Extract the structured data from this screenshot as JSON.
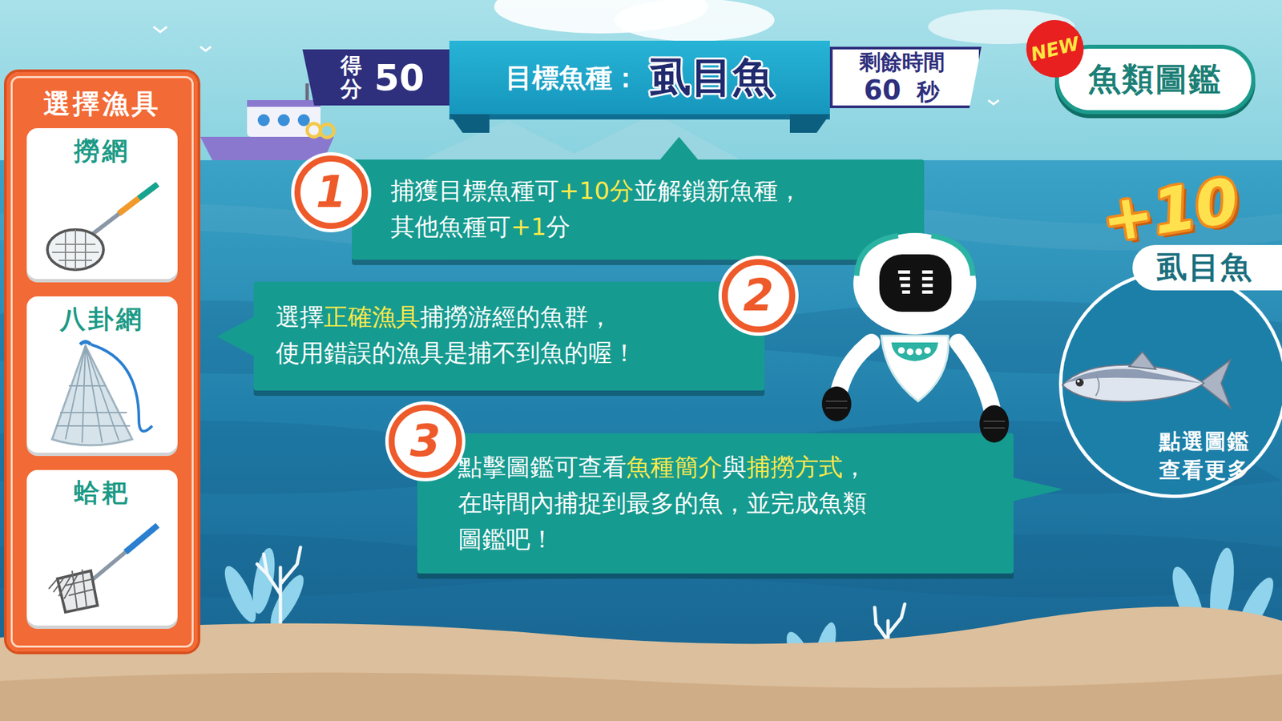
{
  "gear_panel": {
    "title": "選擇漁具",
    "items": [
      {
        "label": "撈網"
      },
      {
        "label": "八卦網"
      },
      {
        "label": "蛤耙"
      }
    ]
  },
  "hud": {
    "score_label": "得分",
    "score": "50",
    "target_label": "目標魚種：",
    "target": "虱目魚",
    "time_label": "剩餘時間",
    "time": "60",
    "time_unit": "秒"
  },
  "guide_button": {
    "badge": "NEW",
    "label": "魚類圖鑑"
  },
  "tips": [
    {
      "number": "1",
      "lines": [
        [
          {
            "text": "捕獲目標魚種可",
            "highlight": false
          },
          {
            "text": "+10分",
            "highlight": true
          },
          {
            "text": "並解鎖新魚種，",
            "highlight": false
          }
        ],
        [
          {
            "text": "其他魚種可",
            "highlight": false
          },
          {
            "text": "+1",
            "highlight": true
          },
          {
            "text": "分",
            "highlight": false
          }
        ]
      ]
    },
    {
      "number": "2",
      "lines": [
        [
          {
            "text": "選擇",
            "highlight": false
          },
          {
            "text": "正確漁具",
            "highlight": true
          },
          {
            "text": "捕撈游經的魚群，",
            "highlight": false
          }
        ],
        [
          {
            "text": "使用錯誤的漁具是捕不到魚的喔！",
            "highlight": false
          }
        ]
      ]
    },
    {
      "number": "3",
      "lines": [
        [
          {
            "text": "點擊圖鑑可查看",
            "highlight": false
          },
          {
            "text": "魚種簡介",
            "highlight": true
          },
          {
            "text": "與",
            "highlight": false
          },
          {
            "text": "捕撈方式",
            "highlight": true
          },
          {
            "text": "，",
            "highlight": false
          }
        ],
        [
          {
            "text": "在時間內捕捉到最多的魚，並完成魚類",
            "highlight": false
          }
        ],
        [
          {
            "text": "圖鑑吧！",
            "highlight": false
          }
        ]
      ]
    }
  ],
  "reward": {
    "points": "+10",
    "fish": "虱目魚",
    "hint_lines": [
      "點選圖鑑",
      "查看更多"
    ]
  }
}
